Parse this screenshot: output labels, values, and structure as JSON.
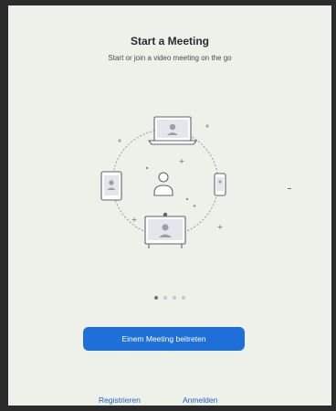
{
  "screen": {
    "title": "Start a Meeting",
    "subtitle": "Start or join a video meeting on the go"
  },
  "carousel": {
    "page_count": 4,
    "active_index": 0
  },
  "buttons": {
    "join_label": "Einem Meeting beitreten"
  },
  "footer": {
    "register_label": "Registrieren",
    "login_label": "Anmelden"
  },
  "colors": {
    "accent": "#1f6fd8",
    "link": "#1d62c9",
    "background": "#eef1ea"
  },
  "icons": [
    "laptop-icon",
    "tablet-icon",
    "phone-icon",
    "user-icon",
    "conference-display-icon"
  ]
}
